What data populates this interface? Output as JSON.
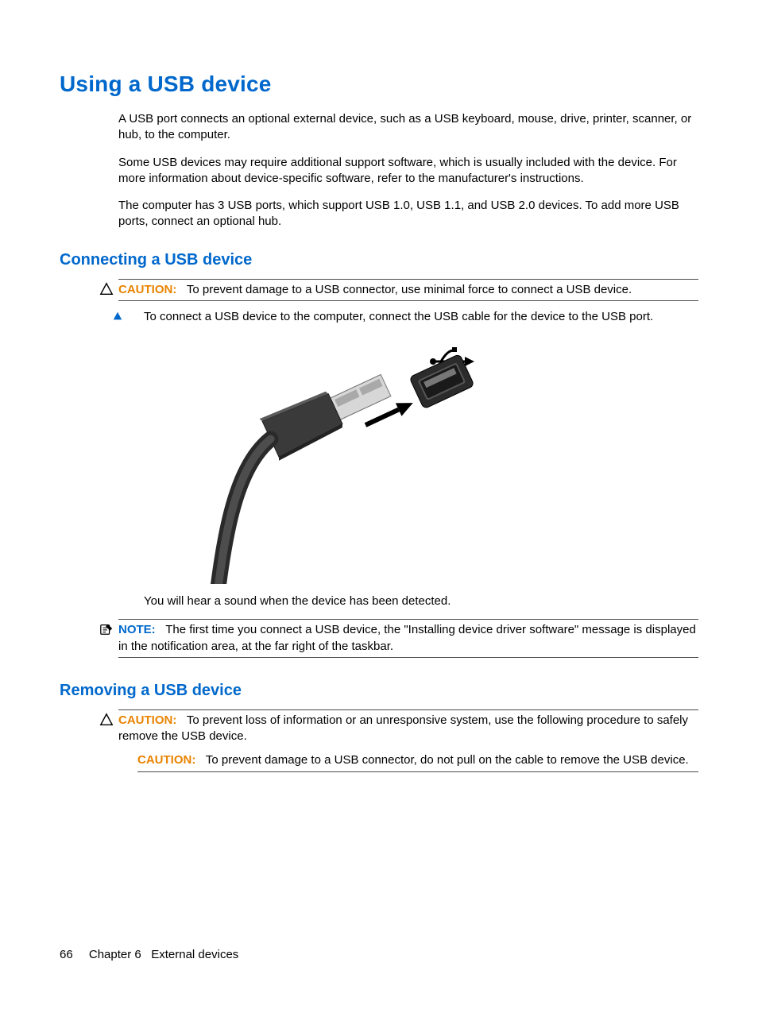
{
  "headings": {
    "h1": "Using a USB device",
    "h2a": "Connecting a USB device",
    "h2b": "Removing a USB device"
  },
  "intro": {
    "p1": "A USB port connects an optional external device, such as a USB keyboard, mouse, drive, printer, scanner, or hub, to the computer.",
    "p2": "Some USB devices may require additional support software, which is usually included with the device. For more information about device-specific software, refer to the manufacturer's instructions.",
    "p3": "The computer has 3 USB ports, which support USB 1.0, USB 1.1, and USB 2.0 devices. To add more USB ports, connect an optional hub."
  },
  "connecting": {
    "caution_label": "CAUTION:",
    "caution_text": "To prevent damage to a USB connector, use minimal force to connect a USB device.",
    "step1": "To connect a USB device to the computer, connect the USB cable for the device to the USB port.",
    "after_image": "You will hear a sound when the device has been detected.",
    "note_label": "NOTE:",
    "note_text": "The first time you connect a USB device, the \"Installing device driver software\" message is displayed in the notification area, at the far right of the taskbar."
  },
  "removing": {
    "caution1_label": "CAUTION:",
    "caution1_text": "To prevent loss of information or an unresponsive system, use the following procedure to safely remove the USB device.",
    "caution2_label": "CAUTION:",
    "caution2_text": "To prevent damage to a USB connector, do not pull on the cable to remove the USB device."
  },
  "footer": {
    "page_num": "66",
    "chapter": "Chapter 6   External devices"
  }
}
